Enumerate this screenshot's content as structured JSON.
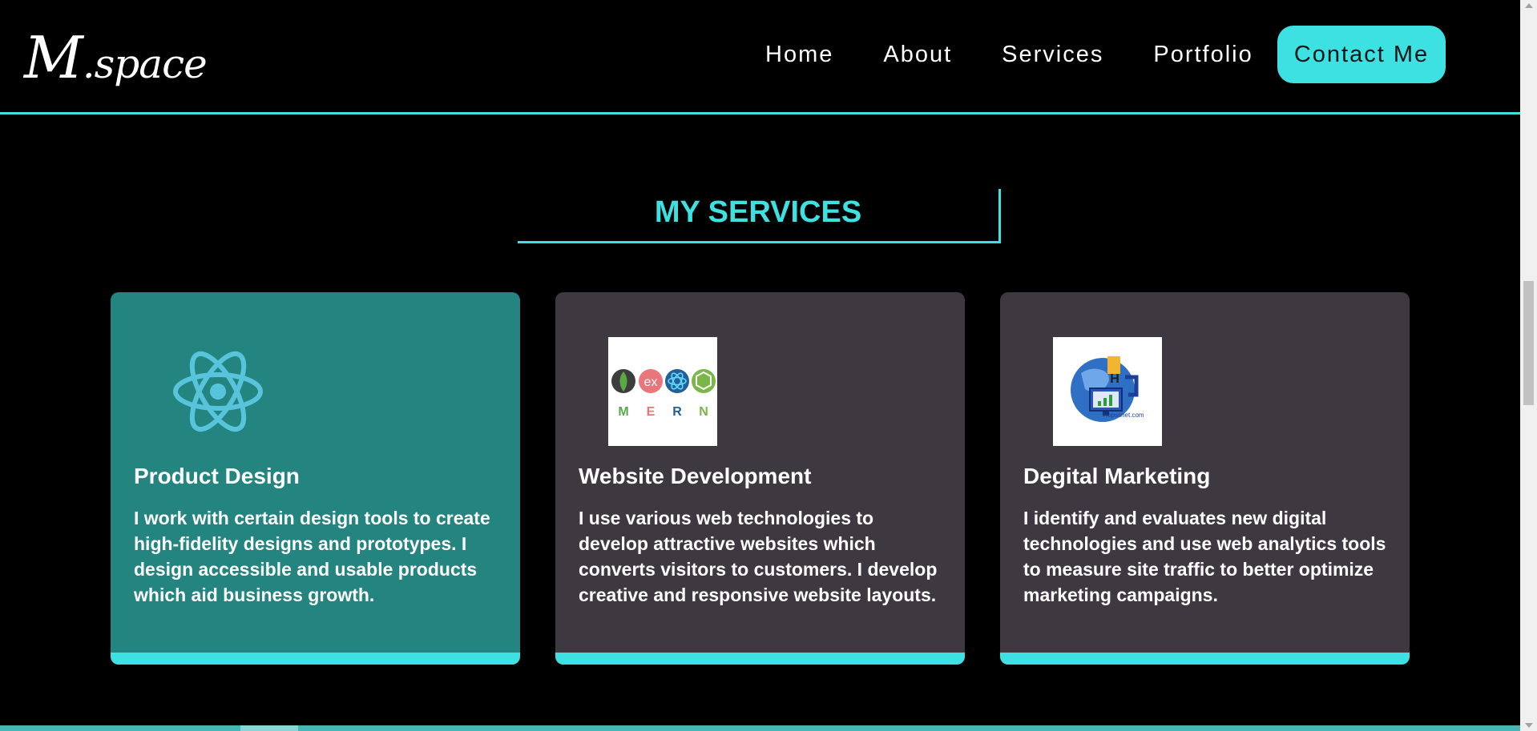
{
  "header": {
    "logo_first": "M",
    "logo_rest": ".space",
    "nav": [
      "Home",
      "About",
      "Services",
      "Portfolio"
    ],
    "contact": "Contact Me"
  },
  "section": {
    "title": "MY SERVICES"
  },
  "cards": [
    {
      "title": "Product Design",
      "text": "I work with certain design tools to create high-fidelity designs and prototypes. I design accessible and usable products which aid business growth.",
      "icon": "react-icon"
    },
    {
      "title": "Website Development",
      "text": "I use various web technologies to develop attractive websites which converts visitors to customers. I develop creative and responsive website layouts.",
      "icon": "mern-stack-image",
      "mern_letters": [
        "M",
        "E",
        "R",
        "N"
      ]
    },
    {
      "title": "Degital Marketing",
      "text": "I identify and evaluates new digital technologies and use web analytics tools to measure site traffic to better optimize marketing campaigns.",
      "icon": "digital-marketing-image",
      "image_caption": "Hopssnet.com"
    }
  ],
  "colors": {
    "accent": "#3de1e1",
    "card_active": "#238480",
    "card": "#3e3840",
    "background": "#000000"
  }
}
